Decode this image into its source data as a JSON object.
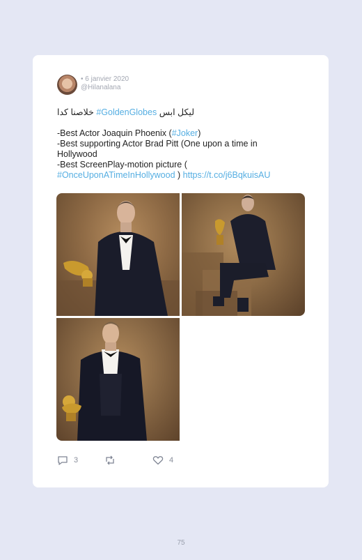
{
  "tweet": {
    "date": "• 6 janvier 2020",
    "handle": "@Hilanalana",
    "arabic_prefix": "خلاصنا كدا",
    "arabic_suffix": "ليكل ابس",
    "hashtag_goldenglobes": "#GoldenGlobes",
    "line1_a": "-Best Actor Joaquin Phoenix (",
    "line1_hashtag": "#Joker",
    "line1_b": ")",
    "line2": "-Best supporting Actor Brad Pitt (One upon a time in",
    "line3": "Hollywood",
    "line4": "-Best ScreenPlay-motion picture (",
    "line5_hashtag": "#OnceUponATimeInHollywood",
    "line5_mid": " ) ",
    "line5_link": "https://t.co/j6BqkuisAU"
  },
  "actions": {
    "reply_count": "3",
    "retweet_count": "",
    "like_count": "4"
  },
  "page_number": "75",
  "colors": {
    "background": "#e4e7f4",
    "card": "#ffffff",
    "link": "#55aee2",
    "meta": "#a3a7b2"
  },
  "icons": [
    "reply-icon",
    "retweet-icon",
    "heart-icon"
  ]
}
